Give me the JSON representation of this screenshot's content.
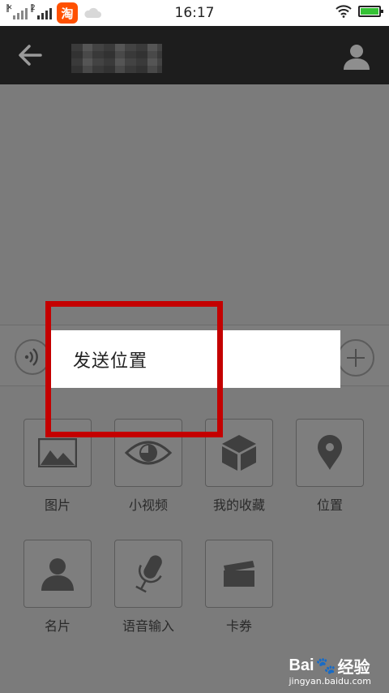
{
  "status_bar": {
    "sim1_tag": "✕",
    "sim2_tag": "2",
    "taobao_app_icon": "淘",
    "time": "16:17",
    "battery_color": "#35c235"
  },
  "header": {
    "back_icon": "arrow-left-icon",
    "profile_icon": "person-icon"
  },
  "popup": {
    "item": "发送位置"
  },
  "tools": [
    {
      "label": "图片",
      "icon": "image-icon"
    },
    {
      "label": "小视频",
      "icon": "eye-icon"
    },
    {
      "label": "我的收藏",
      "icon": "cube-icon"
    },
    {
      "label": "位置",
      "icon": "location-pin-icon"
    },
    {
      "label": "名片",
      "icon": "person-card-icon"
    },
    {
      "label": "语音输入",
      "icon": "microphone-icon"
    },
    {
      "label": "卡券",
      "icon": "card-wallet-icon"
    }
  ],
  "watermark": {
    "brand": "Bai",
    "brand2": "经验",
    "site": "jingyan.baidu.com"
  },
  "colors": {
    "highlight": "#c40000",
    "overlay": "#7b7b7b",
    "header": "#1d1d1d"
  }
}
